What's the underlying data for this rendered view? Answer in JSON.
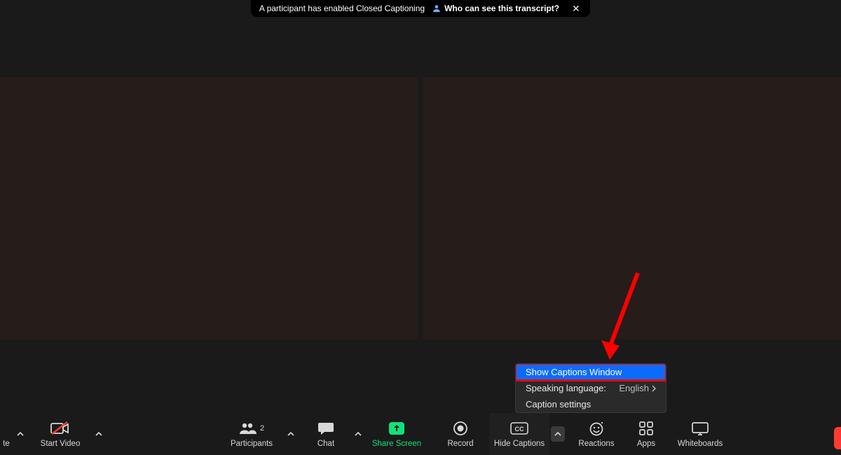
{
  "notification": {
    "text": "A participant has enabled Closed Captioning",
    "link_text": "Who can see this transcript?"
  },
  "toolbar": {
    "mute_label": "te",
    "start_video_label": "Start Video",
    "participants_label": "Participants",
    "participants_count": "2",
    "chat_label": "Chat",
    "share_screen_label": "Share Screen",
    "record_label": "Record",
    "hide_captions_label": "Hide Captions",
    "reactions_label": "Reactions",
    "apps_label": "Apps",
    "whiteboards_label": "Whiteboards"
  },
  "captions_menu": {
    "show_window": "Show Captions Window",
    "speaking_label": "Speaking language:",
    "speaking_value": "English",
    "settings": "Caption settings"
  }
}
